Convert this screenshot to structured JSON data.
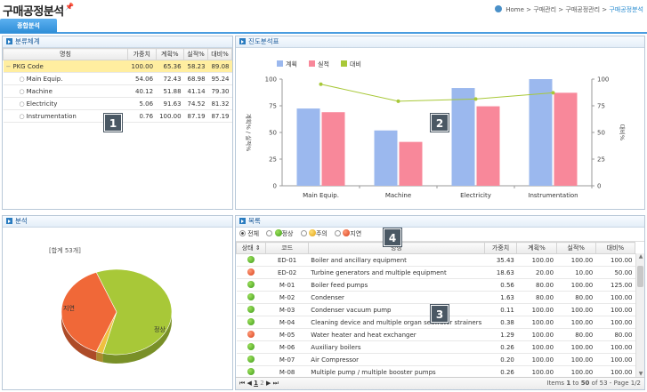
{
  "header": {
    "title": "구매공정분석",
    "pin_icon": "pin-icon",
    "breadcrumb": [
      "Home",
      "구매관리",
      "구매공정관리",
      "구매공정분석"
    ],
    "sep": ">"
  },
  "tabs": [
    {
      "label": "종합분석"
    }
  ],
  "tree_panel": {
    "title": "분류체계",
    "columns": [
      "명칭",
      "가중치",
      "계획%",
      "실적%",
      "대비%"
    ],
    "rows": [
      {
        "name": "PKG Code",
        "w": "100.00",
        "plan": "65.36",
        "act": "58.23",
        "ratio": "89.08"
      },
      {
        "name": "Main Equip.",
        "w": "54.06",
        "plan": "72.43",
        "act": "68.98",
        "ratio": "95.24"
      },
      {
        "name": "Machine",
        "w": "40.12",
        "plan": "51.88",
        "act": "41.14",
        "ratio": "79.30"
      },
      {
        "name": "Electricity",
        "w": "5.06",
        "plan": "91.63",
        "act": "74.52",
        "ratio": "81.32"
      },
      {
        "name": "Instrumentation",
        "w": "0.76",
        "plan": "100.00",
        "act": "87.19",
        "ratio": "87.19"
      }
    ]
  },
  "chart_panel": {
    "title": "진도분석표"
  },
  "chart_data": {
    "type": "bar",
    "categories": [
      "Main Equip.",
      "Machine",
      "Electricity",
      "Instrumentation"
    ],
    "series": [
      {
        "name": "계획",
        "color": "#9bb8ee",
        "values": [
          72.43,
          51.88,
          91.63,
          100
        ]
      },
      {
        "name": "실적",
        "color": "#f8889a",
        "values": [
          68.98,
          41.14,
          74.52,
          87.19
        ]
      },
      {
        "name": "대비",
        "color": "#a8c838",
        "type": "line",
        "axis": "right",
        "values": [
          95.24,
          79.3,
          81.32,
          87.19
        ]
      }
    ],
    "ylabel": "계획% / 실적%",
    "y2label": "대비%",
    "ylim": [
      0,
      100
    ],
    "y2lim": [
      0,
      100
    ],
    "yticks": [
      "0",
      "25",
      "50",
      "75",
      "100"
    ],
    "y2ticks": [
      "0",
      "25",
      "50",
      "75",
      "100"
    ],
    "legend": "top-left",
    "grid": false
  },
  "pie_panel": {
    "title": "분석",
    "total": "[합계 53개]",
    "slices": [
      {
        "label": "정상",
        "value": 60,
        "color": "#a8c838"
      },
      {
        "label": "주의",
        "value": 2,
        "color": "#f0c040"
      },
      {
        "label": "지연",
        "value": 38,
        "color": "#f06838"
      }
    ]
  },
  "list_panel": {
    "title": "목록",
    "filters": [
      {
        "label": "전체",
        "checked": true
      },
      {
        "label": "정상",
        "dot": "g"
      },
      {
        "label": "주의",
        "dot": "y"
      },
      {
        "label": "지연",
        "dot": "r"
      }
    ],
    "columns": [
      "상태",
      "코드",
      "명칭",
      "가중치",
      "계획%",
      "실적%",
      "대비%"
    ],
    "rows": [
      {
        "s": "g",
        "code": "ED-01",
        "name": "Boiler and ancillary equipment",
        "w": "35.43",
        "plan": "100.00",
        "act": "100.00",
        "ratio": "100.00"
      },
      {
        "s": "r",
        "code": "ED-02",
        "name": "Turbine generators and multiple equipment",
        "w": "18.63",
        "plan": "20.00",
        "act": "10.00",
        "ratio": "50.00"
      },
      {
        "s": "g",
        "code": "M-01",
        "name": "Boiler feed pumps",
        "w": "0.56",
        "plan": "80.00",
        "act": "100.00",
        "ratio": "125.00"
      },
      {
        "s": "g",
        "code": "M-02",
        "name": "Condenser",
        "w": "1.63",
        "plan": "80.00",
        "act": "80.00",
        "ratio": "100.00"
      },
      {
        "s": "g",
        "code": "M-03",
        "name": "Condenser vacuum pump",
        "w": "0.11",
        "plan": "100.00",
        "act": "100.00",
        "ratio": "100.00"
      },
      {
        "s": "g",
        "code": "M-04",
        "name": "Cleaning device and multiple organ seawater strainers",
        "w": "0.38",
        "plan": "100.00",
        "act": "100.00",
        "ratio": "100.00"
      },
      {
        "s": "r",
        "code": "M-05",
        "name": "Water heater and heat exchanger",
        "w": "1.29",
        "plan": "100.00",
        "act": "80.00",
        "ratio": "80.00"
      },
      {
        "s": "g",
        "code": "M-06",
        "name": "Auxiliary boilers",
        "w": "0.26",
        "plan": "100.00",
        "act": "100.00",
        "ratio": "100.00"
      },
      {
        "s": "g",
        "code": "M-07",
        "name": "Air Compressor",
        "w": "0.20",
        "plan": "100.00",
        "act": "100.00",
        "ratio": "100.00"
      },
      {
        "s": "g",
        "code": "M-08",
        "name": "Multiple pump / multiple booster pumps",
        "w": "0.26",
        "plan": "100.00",
        "act": "100.00",
        "ratio": "100.00"
      }
    ],
    "pager": {
      "pages": [
        "1",
        "2"
      ],
      "current": "1",
      "info_prefix": "Items",
      "from": "1",
      "to": "50",
      "of": "of",
      "total": "53",
      "page_label": "Page 1/2"
    }
  },
  "badges": [
    "1",
    "2",
    "3",
    "4"
  ]
}
